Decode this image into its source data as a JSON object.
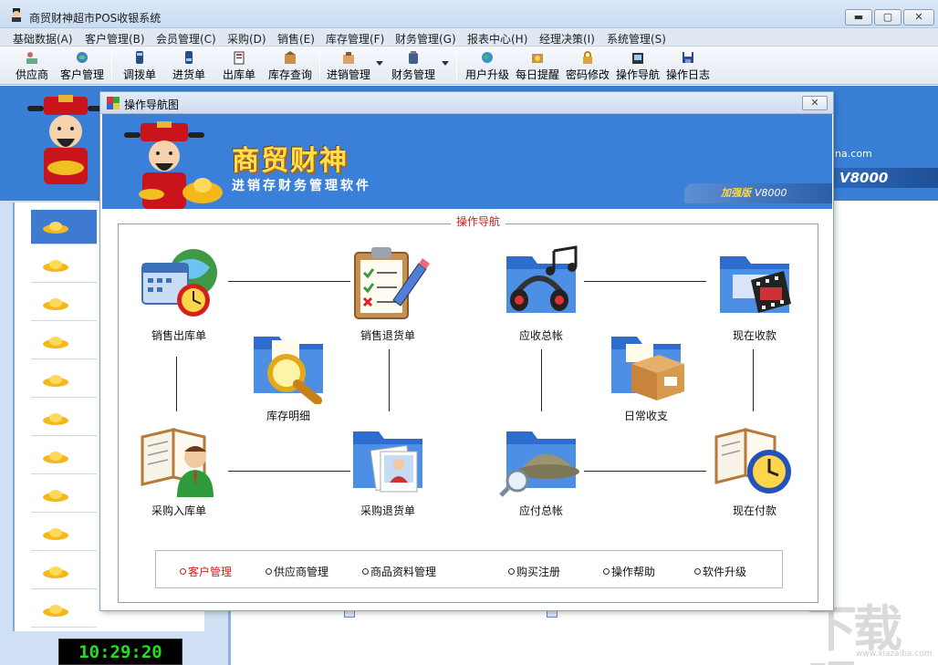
{
  "window": {
    "title": "商贸财神超市POS收银系统",
    "btn_min": "▬",
    "btn_max": "▢",
    "btn_close": "✕"
  },
  "menu": [
    "基础数据(A)",
    "客户管理(B)",
    "会员管理(C)",
    "采购(D)",
    "销售(E)",
    "库存管理(F)",
    "财务管理(G)",
    "报表中心(H)",
    "经理决策(I)",
    "系统管理(S)"
  ],
  "toolbar": [
    {
      "label": "供应商",
      "icon": "supplier-icon"
    },
    {
      "label": "客户管理",
      "icon": "customer-icon"
    },
    {
      "label": "调拨单",
      "icon": "transfer-icon"
    },
    {
      "label": "进货单",
      "icon": "purchase-icon"
    },
    {
      "label": "出库单",
      "icon": "outbound-icon"
    },
    {
      "label": "库存查询",
      "icon": "inventory-icon"
    },
    {
      "label": "进销管理",
      "icon": "sales-mgmt-icon"
    },
    {
      "label": "财务管理",
      "icon": "finance-icon"
    },
    {
      "label": "用户升级",
      "icon": "globe-icon"
    },
    {
      "label": "每日提醒",
      "icon": "reminder-icon"
    },
    {
      "label": "密码修改",
      "icon": "lock-icon"
    },
    {
      "label": "操作导航",
      "icon": "navigation-icon"
    },
    {
      "label": "操作日志",
      "icon": "save-icon"
    }
  ],
  "background": {
    "url_fragment": "ina.com",
    "version": "V8000",
    "clock": "10:29:20"
  },
  "dialog": {
    "title": "操作导航图",
    "close": "✕",
    "brand": "商贸财神",
    "brand_sub": "进销存财务管理软件",
    "edition": "加强版",
    "version": "V8000",
    "panel_title": "操作导航",
    "nodes": {
      "sales_out": "销售出库单",
      "sales_return": "销售退货单",
      "receivable": "应收总帐",
      "cash_receipt": "现在收款",
      "stock_detail": "库存明细",
      "daily": "日常收支",
      "purchase_in": "采购入库单",
      "purchase_return": "采购退货单",
      "payable": "应付总帐",
      "cash_payment": "现在付款"
    },
    "links": [
      "客户管理",
      "供应商管理",
      "商品资料管理",
      "购买注册",
      "操作帮助",
      "软件升级"
    ]
  },
  "watermark": {
    "text": "下载吧",
    "url": "www.xiazaiba.com"
  },
  "colors": {
    "banner_blue": "#3b80d8",
    "accent_red": "#d21d1d",
    "clock_green": "#1fe21f"
  }
}
